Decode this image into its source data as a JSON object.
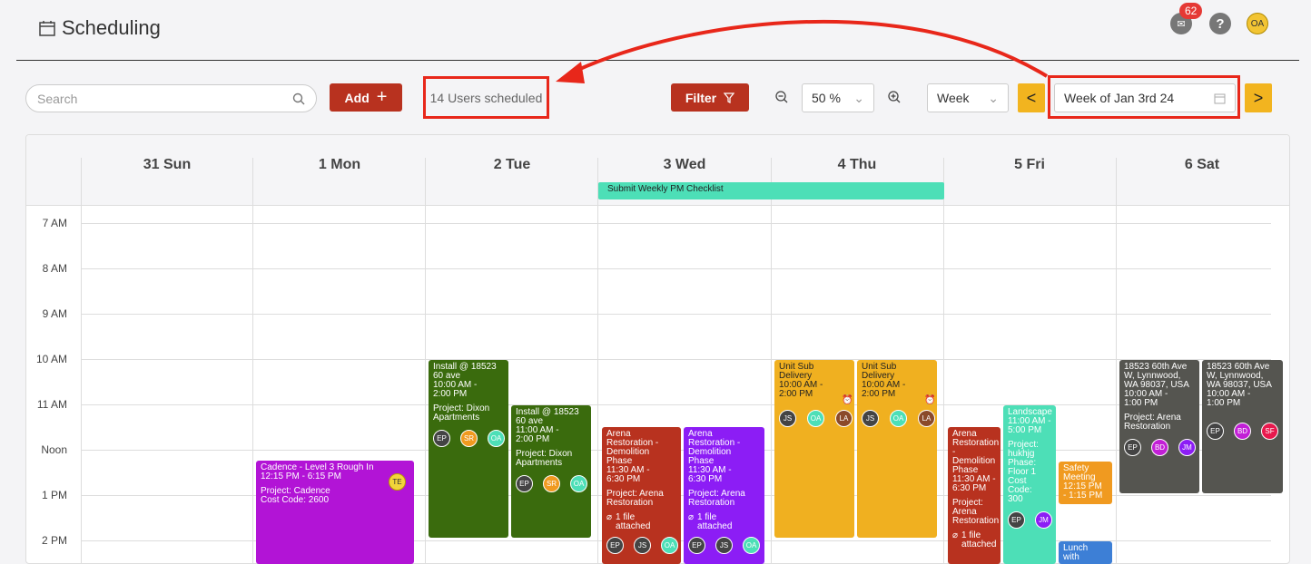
{
  "header": {
    "title": "Scheduling",
    "mail_count": "62",
    "help": "?",
    "user_initials": "OA"
  },
  "toolbar": {
    "search_placeholder": "Search",
    "add_label": "Add",
    "users_scheduled": "14 Users scheduled",
    "filter_label": "Filter",
    "zoom_value": "50 %",
    "view_value": "Week",
    "week_value": "Week of Jan 3rd 24"
  },
  "days": [
    "31 Sun",
    "1 Mon",
    "2 Tue",
    "3 Wed",
    "4 Thu",
    "5 Fri",
    "6 Sat"
  ],
  "times": [
    "7 AM",
    "8 AM",
    "9 AM",
    "10 AM",
    "11 AM",
    "Noon",
    "1 PM",
    "2 PM"
  ],
  "all_day_event": "Submit Weekly PM Checklist",
  "events": [
    {
      "title": "Cadence - Level 3 Rough In\n12:15 PM - 6:15 PM",
      "project": "Project: Cadence\nCost Code: 2600",
      "chips": [
        "TE"
      ],
      "color": "#b214d6"
    },
    {
      "title": "Install @ 18523\n60 ave\n10:00 AM -\n2:00 PM",
      "project": "Project: Dixon\nApartments",
      "chips": [
        "EP",
        "SR",
        "OA"
      ],
      "color": "#3a6b0d"
    },
    {
      "title": "Install @ 18523\n60 ave\n11:00 AM -\n2:00 PM",
      "project": "Project: Dixon\nApartments",
      "chips": [
        "EP",
        "SR",
        "OA"
      ],
      "color": "#3a6b0d"
    },
    {
      "title": "Arena\nRestoration -\nDemolition\nPhase\n11:30 AM -\n6:30 PM",
      "project": "Project: Arena\nRestoration",
      "file": "1 file\nattached",
      "chips": [
        "EP",
        "JS",
        "OA"
      ],
      "color": "#b8321f"
    },
    {
      "title": "Arena\nRestoration -\nDemolition\nPhase\n11:30 AM -\n6:30 PM",
      "project": "Project: Arena\nRestoration",
      "file": "1 file\nattached",
      "chips": [
        "EP",
        "JS",
        "OA"
      ],
      "color": "#8c1df5"
    },
    {
      "title": "Unit Sub\nDelivery\n10:00 AM -\n2:00 PM",
      "chips": [
        "JS",
        "OA",
        "LA"
      ],
      "color": "#f0b020"
    },
    {
      "title": "Unit Sub\nDelivery\n10:00 AM -\n2:00 PM",
      "chips": [
        "JS",
        "OA",
        "LA"
      ],
      "color": "#f0b020"
    },
    {
      "title": "Arena\nRestoration\n-\nDemolition\nPhase\n11:30 AM -\n6:30 PM",
      "project": "Project:\nArena\nRestoration",
      "file": "1 file\nattached",
      "color": "#b8321f"
    },
    {
      "title": "Landscape\n11:00 AM -\n5:00 PM",
      "project": "Project:\nhukhjg\nPhase:\nFloor 1\nCost\nCode:\n300",
      "chips": [
        "EP",
        "JM"
      ],
      "color": "#4ddfb7"
    },
    {
      "title": "Safety\nMeeting\n12:15 PM\n- 1:15 PM",
      "color": "#f09a20"
    },
    {
      "title": "Lunch\nwith",
      "color": "#3d7fd6"
    },
    {
      "title": "18523 60th Ave\nW, Lynnwood,\nWA 98037, USA\n10:00 AM -\n1:00 PM",
      "project": "Project: Arena\nRestoration",
      "chips": [
        "EP",
        "BD",
        "JM"
      ],
      "color": "#555550"
    },
    {
      "title": "18523 60th Ave\nW, Lynnwood,\nWA 98037, USA\n10:00 AM -\n1:00 PM",
      "chips": [
        "EP",
        "BD",
        "SF"
      ],
      "color": "#555550"
    }
  ],
  "chip_colors": {
    "EP": "#444",
    "SR": "#f09a20",
    "OA": "#4ddfb7",
    "TE": "#f2d43a",
    "JS": "#444",
    "LA": "#8b4a2a",
    "JM": "#8c1df5",
    "BD": "#c21fd6",
    "SF": "#e8194d"
  },
  "accent": "#b8321f"
}
